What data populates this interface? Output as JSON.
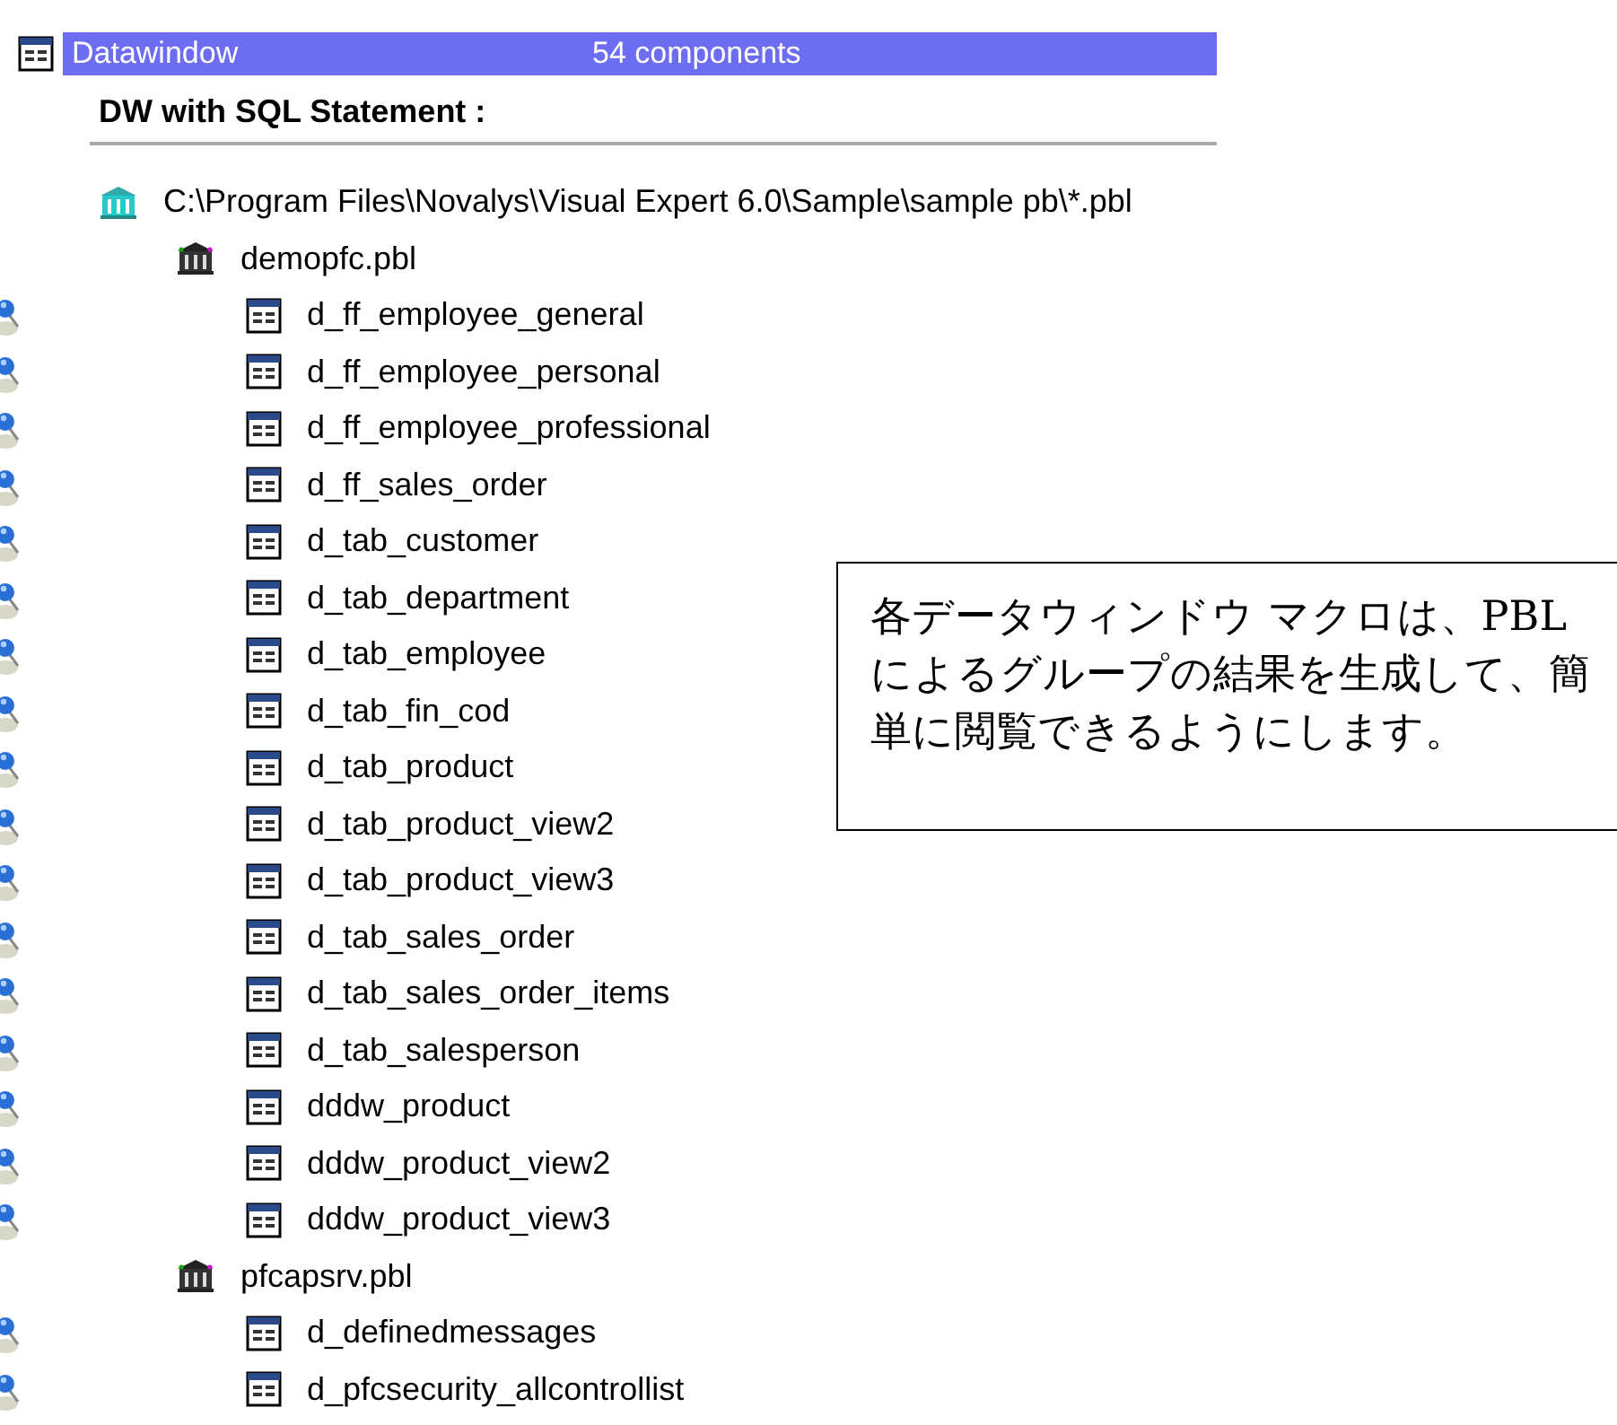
{
  "header": {
    "title": "Datawindow",
    "count": "54 components"
  },
  "section_title": "DW with SQL Statement :",
  "tree": [
    {
      "kind": "root",
      "label": "C:\\Program Files\\Novalys\\Visual Expert 6.0\\Sample\\sample pb\\*.pbl",
      "children": [
        {
          "kind": "library",
          "label": "demopfc.pbl",
          "children": [
            {
              "kind": "datawindow",
              "label": "d_ff_employee_general"
            },
            {
              "kind": "datawindow",
              "label": "d_ff_employee_personal"
            },
            {
              "kind": "datawindow",
              "label": "d_ff_employee_professional"
            },
            {
              "kind": "datawindow",
              "label": "d_ff_sales_order"
            },
            {
              "kind": "datawindow",
              "label": "d_tab_customer"
            },
            {
              "kind": "datawindow",
              "label": "d_tab_department"
            },
            {
              "kind": "datawindow",
              "label": "d_tab_employee"
            },
            {
              "kind": "datawindow",
              "label": "d_tab_fin_cod"
            },
            {
              "kind": "datawindow",
              "label": "d_tab_product"
            },
            {
              "kind": "datawindow",
              "label": "d_tab_product_view2"
            },
            {
              "kind": "datawindow",
              "label": "d_tab_product_view3"
            },
            {
              "kind": "datawindow",
              "label": "d_tab_sales_order"
            },
            {
              "kind": "datawindow",
              "label": "d_tab_sales_order_items"
            },
            {
              "kind": "datawindow",
              "label": "d_tab_salesperson"
            },
            {
              "kind": "datawindow",
              "label": "dddw_product"
            },
            {
              "kind": "datawindow",
              "label": "dddw_product_view2"
            },
            {
              "kind": "datawindow",
              "label": "dddw_product_view3"
            }
          ]
        },
        {
          "kind": "library",
          "label": "pfcapsrv.pbl",
          "children": [
            {
              "kind": "datawindow",
              "label": "d_definedmessages"
            },
            {
              "kind": "datawindow",
              "label": "d_pfcsecurity_allcontrollist"
            }
          ]
        }
      ]
    }
  ],
  "callout": {
    "text": "各データウィンドウ マクロは、PBL によるグループの結果を生成して、簡単に閲覧できるようにします。"
  }
}
